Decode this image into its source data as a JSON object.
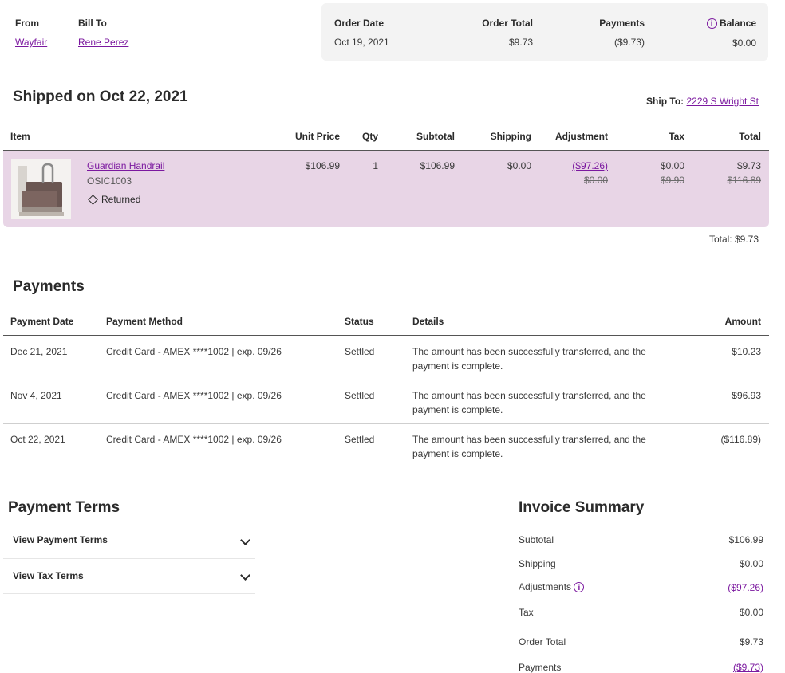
{
  "header": {
    "from_label": "From",
    "from_value": "Wayfair",
    "billto_label": "Bill To",
    "billto_value": "Rene Perez",
    "order_date_label": "Order Date",
    "order_date_value": "Oct 19, 2021",
    "order_total_label": "Order Total",
    "order_total_value": "$9.73",
    "payments_label": "Payments",
    "payments_value": "($9.73)",
    "balance_label": "Balance",
    "balance_value": "$0.00"
  },
  "shipment": {
    "title": "Shipped on Oct 22, 2021",
    "ship_to_label": "Ship To:",
    "ship_to_value": "2229 S Wright St"
  },
  "items_table": {
    "headers": {
      "item": "Item",
      "unit_price": "Unit Price",
      "qty": "Qty",
      "subtotal": "Subtotal",
      "shipping": "Shipping",
      "adjustment": "Adjustment",
      "tax": "Tax",
      "total": "Total"
    },
    "row": {
      "name": "Guardian Handrail",
      "sku": "OSIC1003",
      "status": "Returned",
      "unit_price": "$106.99",
      "qty": "1",
      "subtotal": "$106.99",
      "shipping": "$0.00",
      "adjustment": "($97.26)",
      "adjustment_old": "$0.00",
      "tax": "$0.00",
      "tax_old": "$9.90",
      "total": "$9.73",
      "total_old": "$116.89"
    },
    "footer_total": "Total: $9.73"
  },
  "payments": {
    "title": "Payments",
    "headers": {
      "date": "Payment Date",
      "method": "Payment Method",
      "status": "Status",
      "details": "Details",
      "amount": "Amount"
    },
    "rows": [
      {
        "date": "Dec 21, 2021",
        "method": "Credit Card - AMEX ****1002 | exp. 09/26",
        "status": "Settled",
        "details_1": "The amount has been successfully transferred, and the",
        "details_2": "payment is complete.",
        "amount": "$10.23"
      },
      {
        "date": "Nov 4, 2021",
        "method": "Credit Card - AMEX ****1002 | exp. 09/26",
        "status": "Settled",
        "details_1": "The amount has been successfully transferred, and the",
        "details_2": "payment is complete.",
        "amount": "$96.93"
      },
      {
        "date": "Oct 22, 2021",
        "method": "Credit Card - AMEX ****1002 | exp. 09/26",
        "status": "Settled",
        "details_1": "The amount has been successfully transferred, and the",
        "details_2": "payment is complete.",
        "amount": "($116.89)"
      }
    ]
  },
  "payment_terms": {
    "title": "Payment Terms",
    "view_payment_terms": "View Payment Terms",
    "view_tax_terms": "View Tax Terms"
  },
  "invoice_summary": {
    "title": "Invoice Summary",
    "subtotal_label": "Subtotal",
    "subtotal_value": "$106.99",
    "shipping_label": "Shipping",
    "shipping_value": "$0.00",
    "adjustments_label": "Adjustments",
    "adjustments_value": "($97.26)",
    "tax_label": "Tax",
    "tax_value": "$0.00",
    "order_total_label": "Order Total",
    "order_total_value": "$9.73",
    "payments_label": "Payments",
    "payments_value": "($9.73)"
  },
  "icons": {
    "info": "i"
  },
  "colors": {
    "accent": "#7b189f",
    "row_highlight": "#e8d5e6",
    "summary_bg": "#f3f3f3"
  }
}
